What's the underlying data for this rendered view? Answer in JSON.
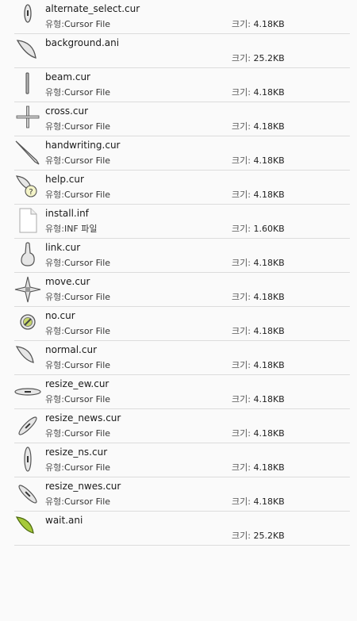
{
  "labels": {
    "type_prefix": "유형:",
    "size_prefix": "크기:"
  },
  "files": [
    {
      "name": "alternate_select.cur",
      "type": "Cursor File",
      "size": "4.18KB",
      "icon": "alt-select-cursor-icon"
    },
    {
      "name": "background.ani",
      "type": "",
      "size": "25.2KB",
      "icon": "busy-pointer-icon"
    },
    {
      "name": "beam.cur",
      "type": "Cursor File",
      "size": "4.18KB",
      "icon": "text-beam-icon"
    },
    {
      "name": "cross.cur",
      "type": "Cursor File",
      "size": "4.18KB",
      "icon": "crosshair-icon"
    },
    {
      "name": "handwriting.cur",
      "type": "Cursor File",
      "size": "4.18KB",
      "icon": "pen-icon"
    },
    {
      "name": "help.cur",
      "type": "Cursor File",
      "size": "4.18KB",
      "icon": "help-pointer-icon"
    },
    {
      "name": "install.inf",
      "type": "INF 파일",
      "size": "1.60KB",
      "icon": "document-icon"
    },
    {
      "name": "link.cur",
      "type": "Cursor File",
      "size": "4.18KB",
      "icon": "hand-link-icon"
    },
    {
      "name": "move.cur",
      "type": "Cursor File",
      "size": "4.18KB",
      "icon": "move-arrows-icon"
    },
    {
      "name": "no.cur",
      "type": "Cursor File",
      "size": "4.18KB",
      "icon": "unavailable-icon"
    },
    {
      "name": "normal.cur",
      "type": "Cursor File",
      "size": "4.18KB",
      "icon": "pointer-icon"
    },
    {
      "name": "resize_ew.cur",
      "type": "Cursor File",
      "size": "4.18KB",
      "icon": "resize-horizontal-icon"
    },
    {
      "name": "resize_news.cur",
      "type": "Cursor File",
      "size": "4.18KB",
      "icon": "resize-diagonal-ne-icon"
    },
    {
      "name": "resize_ns.cur",
      "type": "Cursor File",
      "size": "4.18KB",
      "icon": "resize-vertical-icon"
    },
    {
      "name": "resize_nwes.cur",
      "type": "Cursor File",
      "size": "4.18KB",
      "icon": "resize-diagonal-nw-icon"
    },
    {
      "name": "wait.ani",
      "type": "",
      "size": "25.2KB",
      "icon": "wait-leaf-icon"
    }
  ]
}
